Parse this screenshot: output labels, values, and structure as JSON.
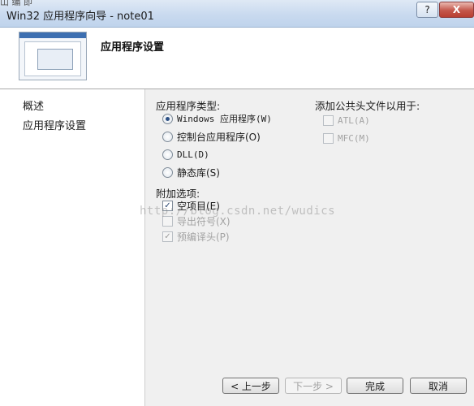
{
  "window": {
    "title": "Win32 应用程序向导 - note01",
    "help_label": "?",
    "close_label": "X",
    "corner_fragment": "山 编 即"
  },
  "header": {
    "title": "应用程序设置"
  },
  "nav": {
    "items": [
      {
        "label": "概述"
      },
      {
        "label": "应用程序设置"
      }
    ]
  },
  "app_type": {
    "label": "应用程序类型:",
    "options": [
      {
        "label": "Windows 应用程序(W)",
        "checked": true
      },
      {
        "label": "控制台应用程序(O)",
        "checked": false
      },
      {
        "label": "DLL(D)",
        "checked": false
      },
      {
        "label": "静态库(S)",
        "checked": false
      }
    ]
  },
  "extra_options": {
    "label": "附加选项:",
    "items": [
      {
        "label": "空项目(E)",
        "checked": true,
        "enabled": true
      },
      {
        "label": "导出符号(X)",
        "checked": false,
        "enabled": false
      },
      {
        "label": "预编译头(P)",
        "checked": true,
        "enabled": false
      }
    ]
  },
  "common_headers": {
    "label": "添加公共头文件以用于:",
    "items": [
      {
        "label": "ATL(A)",
        "checked": false,
        "enabled": false
      },
      {
        "label": "MFC(M)",
        "checked": false,
        "enabled": false
      }
    ]
  },
  "buttons": {
    "prev": "< 上一步",
    "next": "下一步 >",
    "finish": "完成",
    "cancel": "取消"
  },
  "watermark": "http://blog.csdn.net/wudics"
}
